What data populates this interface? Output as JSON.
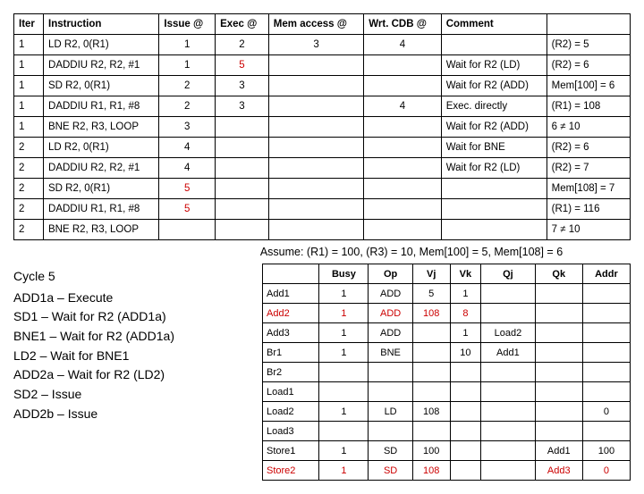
{
  "top": {
    "headers": [
      "Iter",
      "Instruction",
      "Issue @",
      "Exec @",
      "Mem access @",
      "Wrt. CDB @",
      "Comment",
      ""
    ],
    "rows": [
      {
        "iter": "1",
        "instr": "LD R2, 0(R1)",
        "issue": "1",
        "exec": "2",
        "mem": "3",
        "cdb": "4",
        "comment": "",
        "extra": "(R2) = 5"
      },
      {
        "iter": "1",
        "instr": "DADDIU R2, R2, #1",
        "issue": "1",
        "exec": "5",
        "exec_red": true,
        "mem": "",
        "cdb": "",
        "comment": "Wait for R2 (LD)",
        "extra": "(R2) = 6"
      },
      {
        "iter": "1",
        "instr": "SD R2, 0(R1)",
        "issue": "2",
        "exec": "3",
        "mem": "",
        "cdb": "",
        "comment": "Wait for R2 (ADD)",
        "extra": "Mem[100] = 6"
      },
      {
        "iter": "1",
        "instr": "DADDIU R1, R1, #8",
        "issue": "2",
        "exec": "3",
        "mem": "",
        "cdb": "4",
        "comment": "Exec. directly",
        "extra": "(R1) = 108"
      },
      {
        "iter": "1",
        "instr": "BNE R2, R3, LOOP",
        "issue": "3",
        "exec": "",
        "mem": "",
        "cdb": "",
        "comment": "Wait for R2 (ADD)",
        "extra": "6 ≠ 10"
      },
      {
        "iter": "2",
        "instr": "LD R2, 0(R1)",
        "issue": "4",
        "exec": "",
        "mem": "",
        "cdb": "",
        "comment": "Wait for BNE",
        "extra": "(R2) = 6"
      },
      {
        "iter": "2",
        "instr": "DADDIU R2, R2, #1",
        "issue": "4",
        "exec": "",
        "mem": "",
        "cdb": "",
        "comment": "Wait for R2 (LD)",
        "extra": "(R2) = 7"
      },
      {
        "iter": "2",
        "instr": "SD R2, 0(R1)",
        "issue": "5",
        "issue_red": true,
        "exec": "",
        "mem": "",
        "cdb": "",
        "comment": "",
        "extra": "Mem[108] = 7"
      },
      {
        "iter": "2",
        "instr": "DADDIU R1, R1, #8",
        "issue": "5",
        "issue_red": true,
        "exec": "",
        "mem": "",
        "cdb": "",
        "comment": "",
        "extra": "(R1) = 116"
      },
      {
        "iter": "2",
        "instr": "BNE R2, R3, LOOP",
        "issue": "",
        "exec": "",
        "mem": "",
        "cdb": "",
        "comment": "",
        "extra": "7 ≠ 10"
      }
    ]
  },
  "assume": "Assume: (R1) = 100, (R3) = 10, Mem[100] = 5, Mem[108] = 6",
  "cycle": {
    "title": "Cycle 5",
    "lines": [
      "ADD1a – Execute",
      "SD1 – Wait for R2 (ADD1a)",
      "BNE1 – Wait for R2 (ADD1a)",
      "LD2 – Wait for BNE1",
      "ADD2a – Wait for R2 (LD2)",
      "SD2 – Issue",
      "ADD2b – Issue"
    ]
  },
  "res": {
    "headers": [
      "",
      "Busy",
      "Op",
      "Vj",
      "Vk",
      "Qj",
      "Qk",
      "Addr"
    ],
    "rows": [
      {
        "name": "Add1",
        "busy": "1",
        "op": "ADD",
        "vj": "5",
        "vk": "1",
        "qj": "",
        "qk": "",
        "addr": ""
      },
      {
        "name": "Add2",
        "busy": "1",
        "op": "ADD",
        "vj": "108",
        "vk": "8",
        "qj": "",
        "qk": "",
        "addr": "",
        "red": true
      },
      {
        "name": "Add3",
        "busy": "1",
        "op": "ADD",
        "vj": "",
        "vk": "1",
        "qj": "Load2",
        "qk": "",
        "addr": ""
      },
      {
        "name": "Br1",
        "busy": "1",
        "op": "BNE",
        "vj": "",
        "vk": "10",
        "qj": "Add1",
        "qk": "",
        "addr": ""
      },
      {
        "name": "Br2",
        "busy": "",
        "op": "",
        "vj": "",
        "vk": "",
        "qj": "",
        "qk": "",
        "addr": ""
      },
      {
        "name": "Load1",
        "busy": "",
        "op": "",
        "vj": "",
        "vk": "",
        "qj": "",
        "qk": "",
        "addr": ""
      },
      {
        "name": "Load2",
        "busy": "1",
        "op": "LD",
        "vj": "108",
        "vk": "",
        "qj": "",
        "qk": "",
        "addr": "0"
      },
      {
        "name": "Load3",
        "busy": "",
        "op": "",
        "vj": "",
        "vk": "",
        "qj": "",
        "qk": "",
        "addr": ""
      },
      {
        "name": "Store1",
        "busy": "1",
        "op": "SD",
        "vj": "100",
        "vk": "",
        "qj": "",
        "qk": "Add1",
        "addr": "100"
      },
      {
        "name": "Store2",
        "busy": "1",
        "op": "SD",
        "vj": "108",
        "vk": "",
        "qj": "",
        "qk": "Add3",
        "addr": "0",
        "red": true
      }
    ]
  }
}
